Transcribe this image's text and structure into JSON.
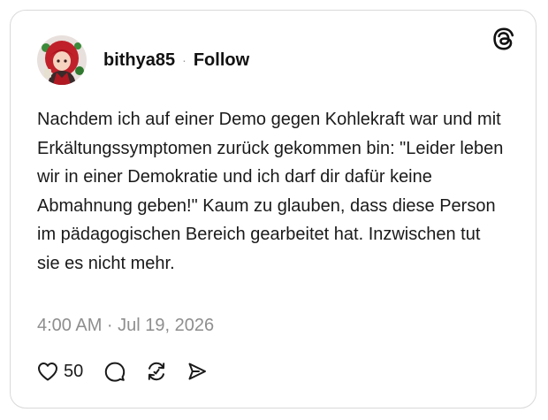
{
  "post": {
    "username": "bithya85",
    "separator": "·",
    "follow_label": "Follow",
    "text": "Nachdem ich auf einer Demo gegen Kohlekraft war und mit Erkältungssymptomen zurück gekommen bin: \"Leider leben wir in einer Demokratie und ich darf dir dafür keine Abmahnung geben!\" Kaum zu glauben, dass diese Person im pädagogischen Bereich gearbeitet hat. Inzwischen tut sie es nicht mehr.",
    "timestamp": "4:00 AM · Jul 19, 2026",
    "like_count": "50"
  },
  "icons": {
    "brand": "threads-logo-icon",
    "like": "heart-icon",
    "reply": "comment-icon",
    "repost": "repost-icon",
    "share": "send-icon"
  },
  "colors": {
    "text": "#1a1a1a",
    "muted": "#8e8e8e",
    "border": "#d9d9d9"
  }
}
